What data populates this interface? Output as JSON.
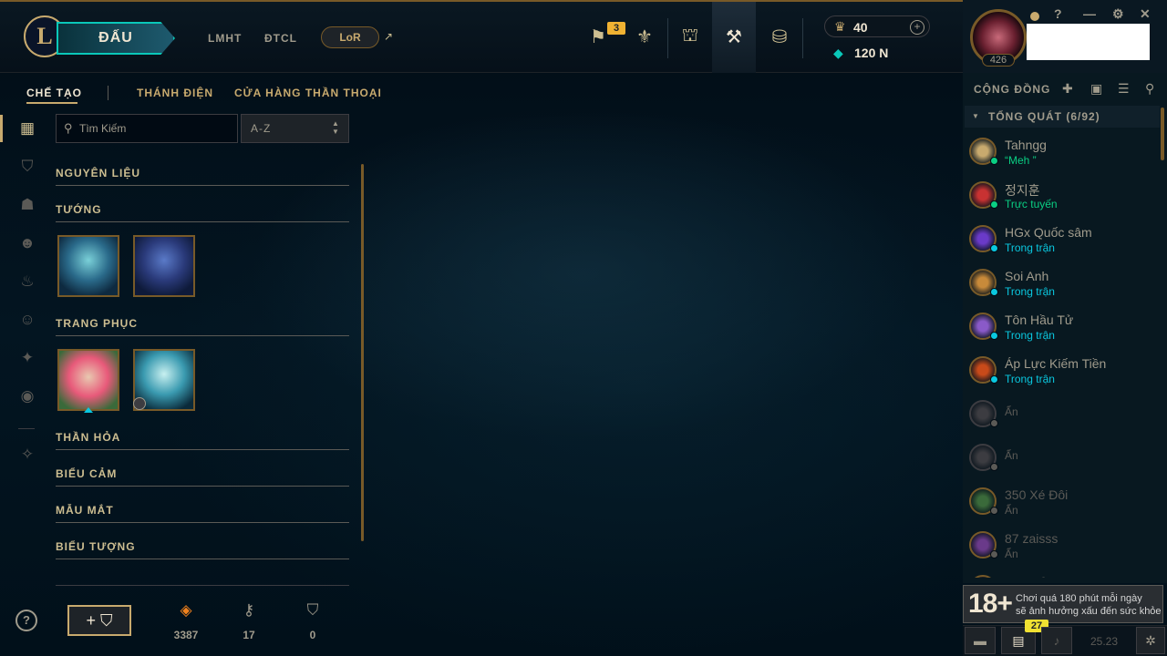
{
  "topbar": {
    "logo": "L",
    "play_label": "ĐẤU",
    "nav": [
      "LMHT",
      "ĐTCL"
    ],
    "lor_label": "LoR",
    "lor_arrow": "↗",
    "missions_badge": "3",
    "rp": "40",
    "blue_essence": "120 N",
    "window_controls": [
      "?",
      "—",
      "⚙",
      "✕"
    ],
    "icons": [
      "clash-icon",
      "honor-icon",
      "store-bag-icon",
      "loot-icon",
      "coins-icon"
    ]
  },
  "profile": {
    "level": "426"
  },
  "subnav": {
    "tabs": [
      "CHẾ TẠO",
      "THÁNH ĐIỆN",
      "CỬA HÀNG THẦN THOẠI"
    ]
  },
  "search": {
    "placeholder": "Tìm Kiếm",
    "sort": "A-Z"
  },
  "categories": [
    "NGUYÊN LIỆU",
    "TƯỚNG",
    "TRANG PHỤC",
    "THẦN HỎA",
    "BIỂU CẢM",
    "MẪU MẮT",
    "BIỂU TƯỢNG"
  ],
  "bottom": {
    "help": "?",
    "add_label": "+ ⛉",
    "currencies": [
      {
        "icon": "orange-essence-icon",
        "value": "3387"
      },
      {
        "icon": "key-icon",
        "value": "17"
      },
      {
        "icon": "chest-icon",
        "value": "0"
      }
    ]
  },
  "social": {
    "title": "CỘNG ĐỒNG",
    "group": "TỔNG QUÁT (6/92)",
    "friends": [
      {
        "name": "Tahngg",
        "status": "“Meh ”",
        "color": "#0acf83"
      },
      {
        "name": "정지훈",
        "status": "Trực tuyến",
        "color": "#0acf83"
      },
      {
        "name": "HGx Quốc sâm",
        "status": "Trong trận",
        "color": "#0ac8e0"
      },
      {
        "name": "Soi Anh",
        "status": "Trong trận",
        "color": "#0ac8e0"
      },
      {
        "name": "Tôn Hầu Tử",
        "status": "Trong trận",
        "color": "#0ac8e0"
      },
      {
        "name": "Áp Lực Kiếm Tiền",
        "status": "Trong trận",
        "color": "#0ac8e0"
      },
      {
        "name": "",
        "status": "Ẩn",
        "color": "#5b5a56"
      },
      {
        "name": "",
        "status": "Ẩn",
        "color": "#5b5a56"
      },
      {
        "name": "350 Xé Đôi",
        "status": "Ẩn",
        "color": "#5b5a56"
      },
      {
        "name": "87 zaisss",
        "status": "Ẩn",
        "color": "#5b5a56"
      },
      {
        "name": "Anh Của Năm",
        "status": "",
        "color": "#5b5a56"
      }
    ]
  },
  "warning": {
    "age": "18+",
    "line1": "Chơi quá 180 phút mỗi ngày",
    "line2": "sẽ ảnh hưởng xấu đến sức khỏe"
  },
  "statusbar": {
    "badge": "27",
    "clock": "25.23"
  }
}
